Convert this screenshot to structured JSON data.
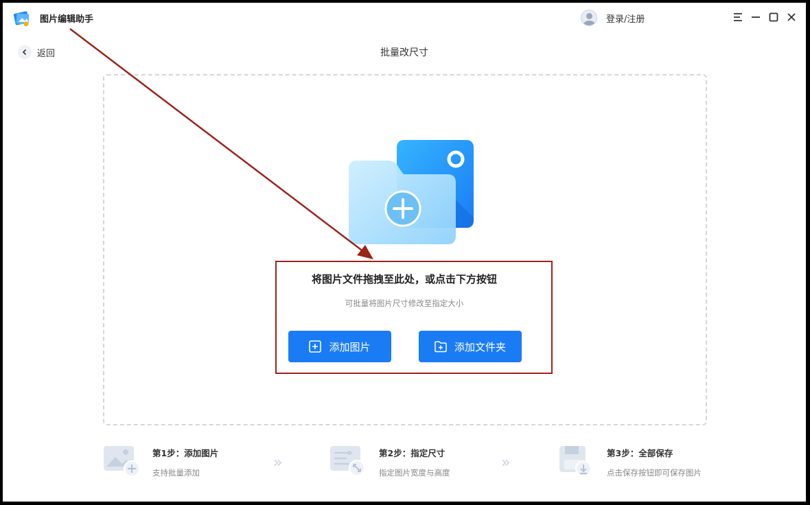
{
  "app": {
    "title": "图片编辑助手"
  },
  "header": {
    "login_label": "登录/注册",
    "back_label": "返回",
    "page_title": "批量改尺寸"
  },
  "dropzone": {
    "title": "将图片文件拖拽至此处，或点击下方按钮",
    "subtitle": "可批量将图片尺寸修改至指定大小",
    "add_image_label": "添加图片",
    "add_folder_label": "添加文件夹"
  },
  "steps": [
    {
      "title": "第1步：添加图片",
      "desc": "支持批量添加",
      "icon": "add-image-icon"
    },
    {
      "title": "第2步：指定尺寸",
      "desc": "指定图片宽度与高度",
      "icon": "resize-icon"
    },
    {
      "title": "第3步：全部保存",
      "desc": "点击保存按钮即可保存图片",
      "icon": "save-icon"
    }
  ],
  "step_separator": "»",
  "colors": {
    "primary": "#1a7cf5",
    "annotation": "#9c2318",
    "dashed_border": "#d3d7dd"
  }
}
